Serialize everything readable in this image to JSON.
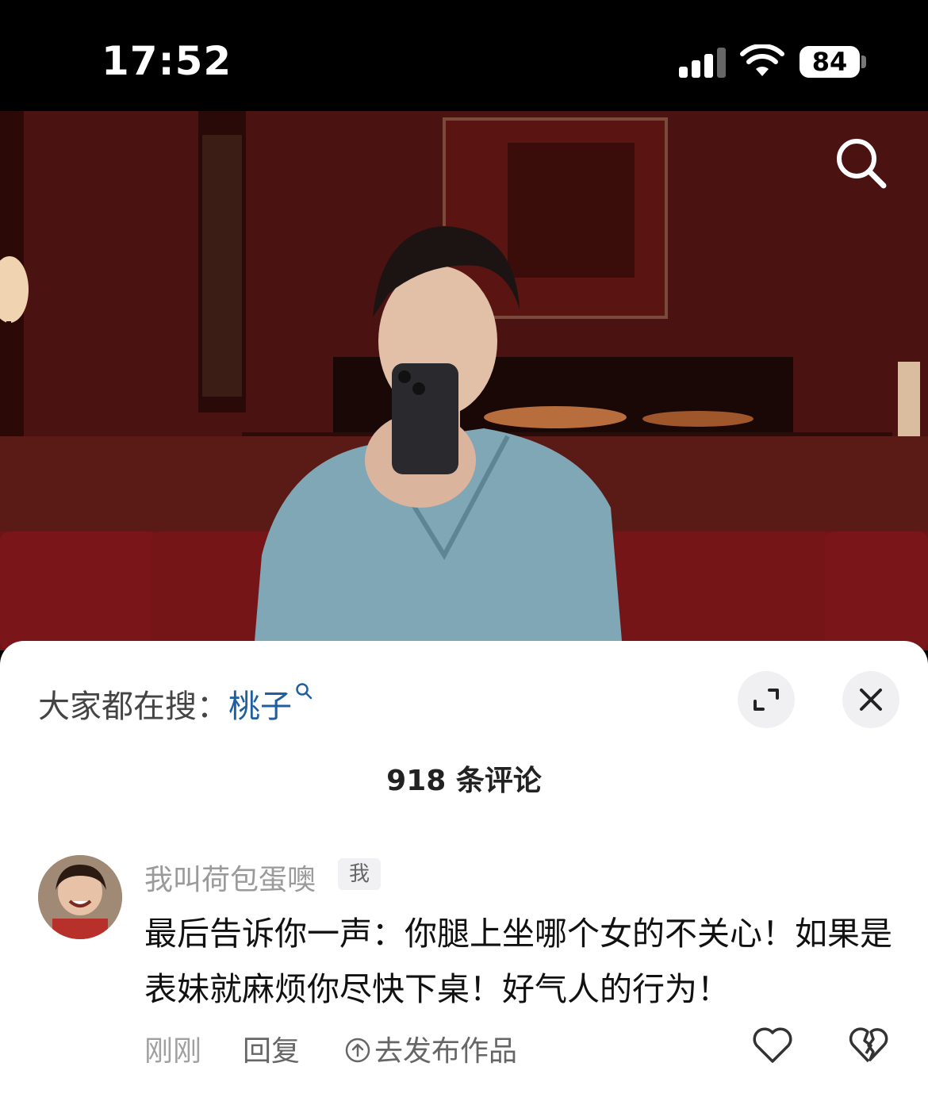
{
  "status_bar": {
    "time": "17:52",
    "battery": "84"
  },
  "video": {
    "search_icon": "search-icon"
  },
  "sheet": {
    "search_hint_prefix": "大家都在搜：",
    "search_keyword": "桃子",
    "comment_count": "918 条评论",
    "expand_icon": "expand-icon",
    "close_icon": "close-icon"
  },
  "comment": {
    "username": "我叫荷包蛋噢",
    "badge": "我",
    "text": "最后告诉你一声：你腿上坐哪个女的不关心！如果是表妹就麻烦你尽快下桌！好气人的行为！",
    "time": "刚刚",
    "reply_label": "回复",
    "publish_label": "去发布作品"
  }
}
